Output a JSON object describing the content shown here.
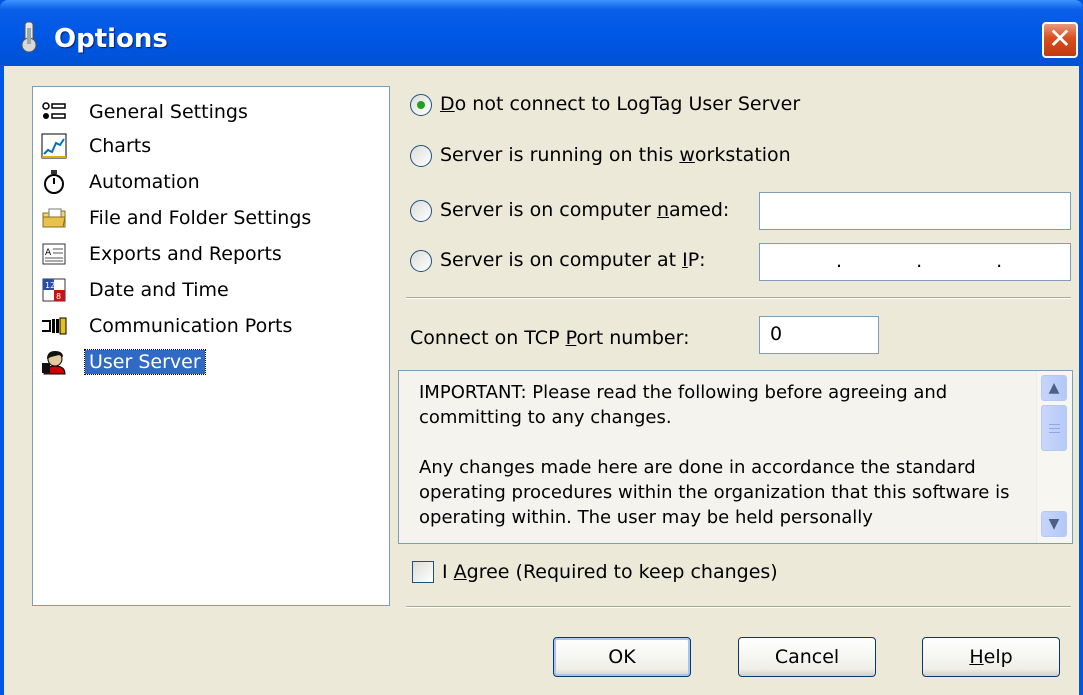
{
  "window": {
    "title": "Options"
  },
  "tree": {
    "items": [
      {
        "label": "General Settings",
        "icon": "general-settings-icon"
      },
      {
        "label": "Charts",
        "icon": "chart-icon"
      },
      {
        "label": "Automation",
        "icon": "stopwatch-icon"
      },
      {
        "label": "File and Folder Settings",
        "icon": "folder-icon"
      },
      {
        "label": "Exports and Reports",
        "icon": "report-icon"
      },
      {
        "label": "Date and Time",
        "icon": "calendar-icon"
      },
      {
        "label": "Communication Ports",
        "icon": "ports-icon"
      },
      {
        "label": "User Server",
        "icon": "user-server-icon",
        "selected": true
      }
    ]
  },
  "server": {
    "options": [
      {
        "pre": "",
        "u": "D",
        "post": "o not connect to LogTag User Server",
        "checked": true
      },
      {
        "pre": "Server is running on this ",
        "u": "w",
        "post": "orkstation",
        "checked": false
      },
      {
        "pre": "Server is on computer ",
        "u": "n",
        "post": "amed:",
        "checked": false
      },
      {
        "pre": "Server is on computer at ",
        "u": "I",
        "post": "P:",
        "checked": false
      }
    ],
    "computer_name": "",
    "ip_address": ". . ."
  },
  "port": {
    "label_pre": "Connect on TCP ",
    "label_u": "P",
    "label_post": "ort number:",
    "value": "0"
  },
  "notice": {
    "text": "IMPORTANT: Please read the following before agreeing and committing to any changes.\n\nAny changes made here are done in accordance the standard operating procedures within the organization that this software is operating within. The user may be held personally"
  },
  "agree": {
    "pre": "I ",
    "u": "A",
    "post": "gree (Required to keep changes)",
    "checked": false
  },
  "buttons": {
    "ok": "OK",
    "cancel": "Cancel",
    "help_u": "H",
    "help_post": "elp"
  },
  "colors": {
    "selection": "#316ac5",
    "titlebar": "#0058e6",
    "face": "#ece9d8"
  }
}
